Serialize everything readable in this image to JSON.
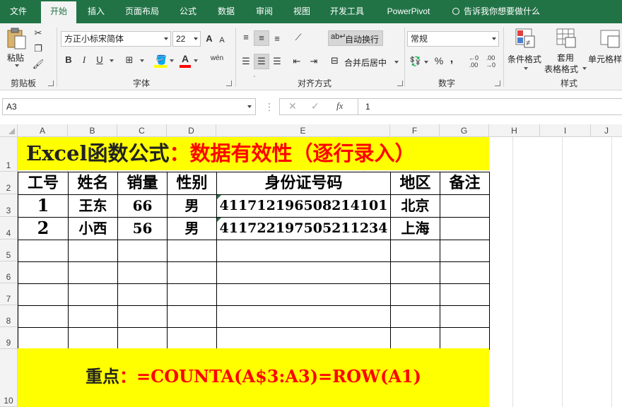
{
  "tabs": [
    "文件",
    "开始",
    "插入",
    "页面布局",
    "公式",
    "数据",
    "审阅",
    "视图",
    "开发工具",
    "Power Pivot"
  ],
  "active_tab": "开始",
  "tell_me": "告诉我你想要做什么",
  "ribbon": {
    "paste_label": "粘贴",
    "clipboard_label": "剪贴板",
    "font_name": "方正小标宋简体",
    "font_size": "22",
    "font_group_label": "字体",
    "bold": "B",
    "italic": "I",
    "underline": "U",
    "wrap_text": "自动换行",
    "merge_center": "合并后居中",
    "align_group_label": "对齐方式",
    "number_format": "常规",
    "number_group_label": "数字",
    "percent": "%",
    "comma": ",",
    "cond_format": "条件格式",
    "table_format_1": "套用",
    "table_format_2": "表格格式",
    "cell_style": "单元格样",
    "styles_group_label": "样式",
    "font_increase": "A",
    "font_decrease": "A",
    "wen": "wén"
  },
  "formula_bar": {
    "name_box": "A3",
    "fx": "fx",
    "value": "1"
  },
  "columns": [
    "A",
    "B",
    "C",
    "D",
    "E",
    "F",
    "G",
    "H",
    "I",
    "J"
  ],
  "rows": [
    "1",
    "2",
    "3",
    "4",
    "5",
    "6",
    "7",
    "8",
    "9",
    "10"
  ],
  "sheet": {
    "title_black": "Excel函数公式",
    "title_red": "：数据有效性（逐行录入）",
    "headers": [
      "工号",
      "姓名",
      "销量",
      "性别",
      "身份证号码",
      "地区",
      "备注"
    ],
    "data_rows": [
      [
        "1",
        "王东",
        "66",
        "男",
        "41171219650821410 1",
        "北京",
        ""
      ],
      [
        "2",
        "小西",
        "56",
        "男",
        "41172219750521123 4",
        "上海",
        ""
      ]
    ],
    "footer_black": "重点",
    "footer_red": "：=COUNTA(A$3:A3)=ROW(A1)"
  },
  "colors": {
    "excel_green": "#217346",
    "highlight_yellow": "#ffff00",
    "red_text": "#ff0000"
  }
}
